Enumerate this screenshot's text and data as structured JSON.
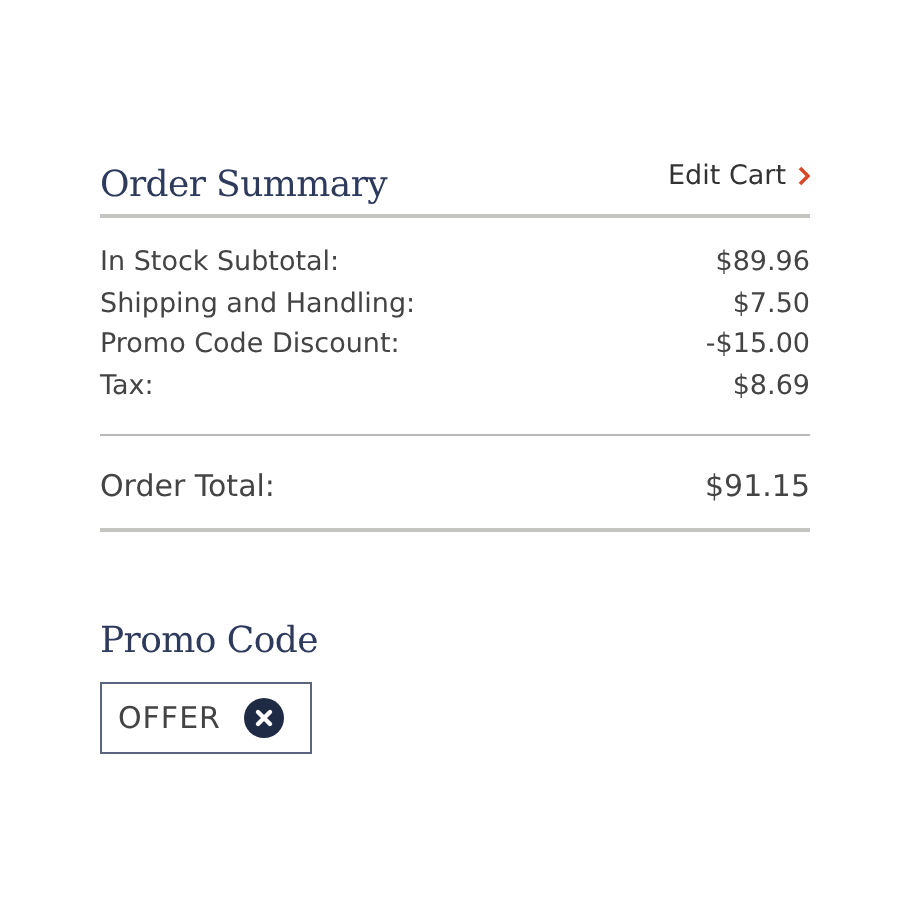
{
  "summary": {
    "title": "Order Summary",
    "edit_link": "Edit Cart",
    "lines": [
      {
        "label": "In Stock Subtotal:",
        "amount": "$89.96"
      },
      {
        "label": "Shipping and Handling:",
        "amount": "$7.50"
      },
      {
        "label": "Promo Code Discount:",
        "amount": "-$15.00"
      },
      {
        "label": "Tax:",
        "amount": "$8.69"
      }
    ],
    "total": {
      "label": "Order Total:",
      "amount": "$91.15"
    }
  },
  "promo": {
    "title": "Promo Code",
    "code": "OFFER"
  }
}
